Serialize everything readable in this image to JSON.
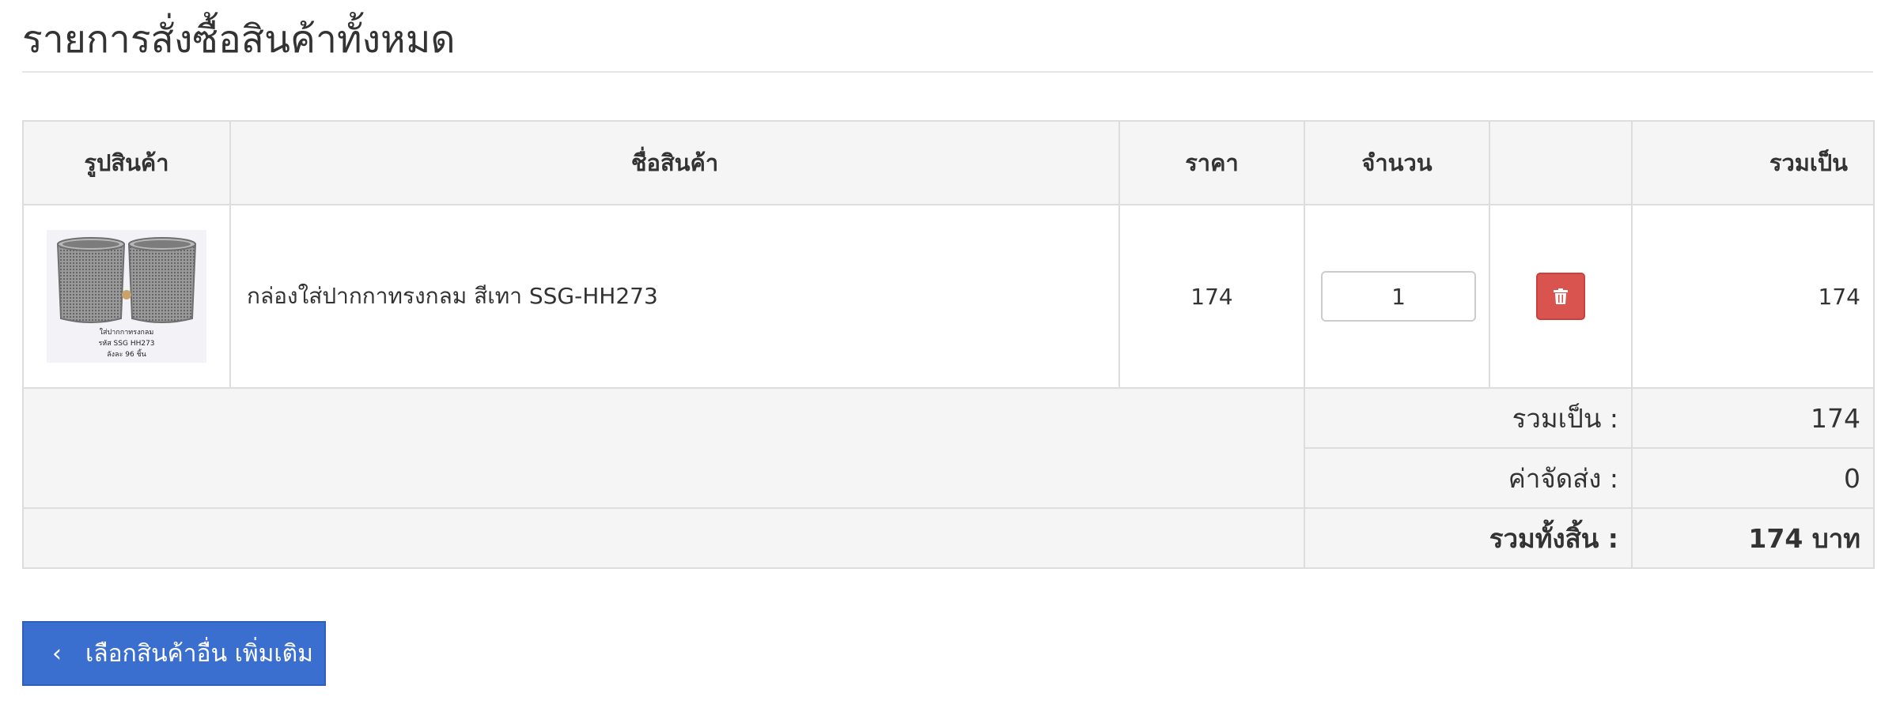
{
  "page": {
    "title": "รายการสั่งซื้อสินค้าทั้งหมด"
  },
  "table": {
    "headers": {
      "image": "รูปสินค้า",
      "name": "ชื่อสินค้า",
      "price": "ราคา",
      "qty": "จำนวน",
      "total": "รวมเป็น"
    },
    "items": [
      {
        "image_caption_1": "ใส่ปากกาทรงกลม",
        "image_caption_2": "รหัส SSG HH273",
        "image_caption_3": "ลังละ 96 ชิ้น",
        "name": "กล่องใส่ปากกาทรงกลม สีเทา SSG-HH273",
        "price": "174",
        "qty": "1",
        "line_total": "174",
        "delete_icon": "trash-icon"
      }
    ],
    "summary": {
      "subtotal_label": "รวมเป็น :",
      "subtotal_value": "174",
      "shipping_label": "ค่าจัดส่ง :",
      "shipping_value": "0",
      "grand_label": "รวมทั้งสิ้น :",
      "grand_value": "174 บาท"
    }
  },
  "actions": {
    "continue_label": "เลือกสินค้าอื่น เพิ่มเติม",
    "continue_icon": "chevron-left-icon"
  },
  "colors": {
    "primary_button": "#3a6fd0",
    "danger_button": "#d9534f",
    "header_bg": "#f5f5f5",
    "border": "#dddddd"
  }
}
